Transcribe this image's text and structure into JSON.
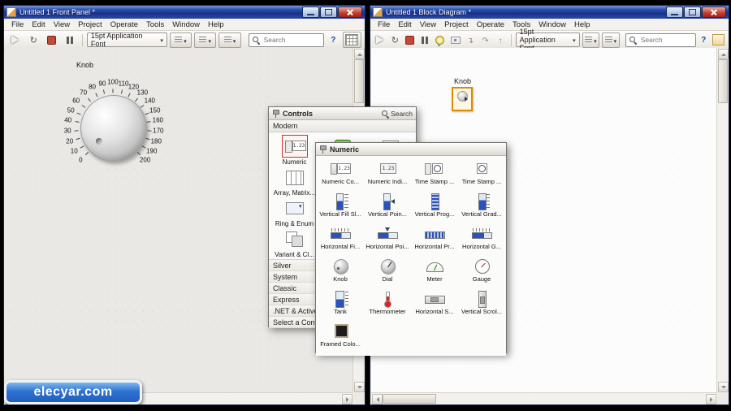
{
  "frame": {
    "watermark": "elecyar.com"
  },
  "front_panel": {
    "title": "Untitled 1 Front Panel *",
    "menus": [
      "File",
      "Edit",
      "View",
      "Project",
      "Operate",
      "Tools",
      "Window",
      "Help"
    ],
    "toolbar": {
      "font_selector": "15pt Application Font",
      "search_placeholder": "Search",
      "help_label": "?"
    },
    "knob": {
      "label": "Knob",
      "ticks": [
        "0",
        "10",
        "20",
        "30",
        "40",
        "50",
        "60",
        "70",
        "80",
        "90",
        "100",
        "110",
        "120",
        "130",
        "140",
        "150",
        "160",
        "170",
        "180",
        "190",
        "200"
      ]
    }
  },
  "block_diagram": {
    "title": "Untitled 1 Block Diagram *",
    "menus": [
      "File",
      "Edit",
      "View",
      "Project",
      "Operate",
      "Tools",
      "Window",
      "Help"
    ],
    "toolbar": {
      "font_selector": "15pt Application Font",
      "search_placeholder": "Search",
      "help_label": "?"
    },
    "terminal": {
      "label": "Knob"
    }
  },
  "controls_palette": {
    "title": "Controls",
    "search_label": "Search",
    "category": "Modern",
    "expand_arrow": "▸",
    "grid": [
      {
        "label": "Numeric",
        "icon": "cp-numeric",
        "highlighted": true
      },
      {
        "label": "",
        "icon": "cp-boolean",
        "highlighted": false
      },
      {
        "label": "",
        "icon": "cp-string",
        "highlighted": false
      },
      {
        "label": "Array, Matrix...",
        "icon": "cp-array",
        "highlighted": false
      },
      {
        "label": "Ring & Enum",
        "icon": "cp-ring",
        "highlighted": false
      },
      {
        "label": "Variant & Cl...",
        "icon": "cp-variant",
        "highlighted": false
      }
    ],
    "categories": [
      "Silver",
      "System",
      "Classic",
      "Express",
      ".NET & ActiveX",
      "Select a Control..."
    ]
  },
  "numeric_palette": {
    "title": "Numeric",
    "items": [
      {
        "label": "Numeric Co...",
        "icon": "numctrl"
      },
      {
        "label": "Numeric Indi...",
        "icon": "numind"
      },
      {
        "label": "Time Stamp ...",
        "icon": "timectrl"
      },
      {
        "label": "Time Stamp ...",
        "icon": "timeind"
      },
      {
        "label": "Vertical Fill Sl...",
        "icon": "vfill"
      },
      {
        "label": "Vertical Poin...",
        "icon": "vptr"
      },
      {
        "label": "Vertical Prog...",
        "icon": "vprog"
      },
      {
        "label": "Vertical Grad...",
        "icon": "vgrad"
      },
      {
        "label": "Horizontal Fi...",
        "icon": "hfill"
      },
      {
        "label": "Horizontal Poi...",
        "icon": "hptr"
      },
      {
        "label": "Horizontal Pr...",
        "icon": "hprog"
      },
      {
        "label": "Horizontal G...",
        "icon": "hgrad"
      },
      {
        "label": "Knob",
        "icon": "knob"
      },
      {
        "label": "Dial",
        "icon": "dial"
      },
      {
        "label": "Meter",
        "icon": "meter"
      },
      {
        "label": "Gauge",
        "icon": "gauge"
      },
      {
        "label": "Tank",
        "icon": "tank"
      },
      {
        "label": "Thermometer",
        "icon": "thermo"
      },
      {
        "label": "Horizontal S...",
        "icon": "hscroll"
      },
      {
        "label": "Vertical Scrol...",
        "icon": "vscroll"
      },
      {
        "label": "Framed Colo...",
        "icon": "colorbox"
      }
    ]
  },
  "colors": {
    "accent_blue": "#2a52be",
    "terminal_orange": "#e08a00",
    "highlight_red": "#d03020",
    "titlebar_blue": "#16318c"
  }
}
